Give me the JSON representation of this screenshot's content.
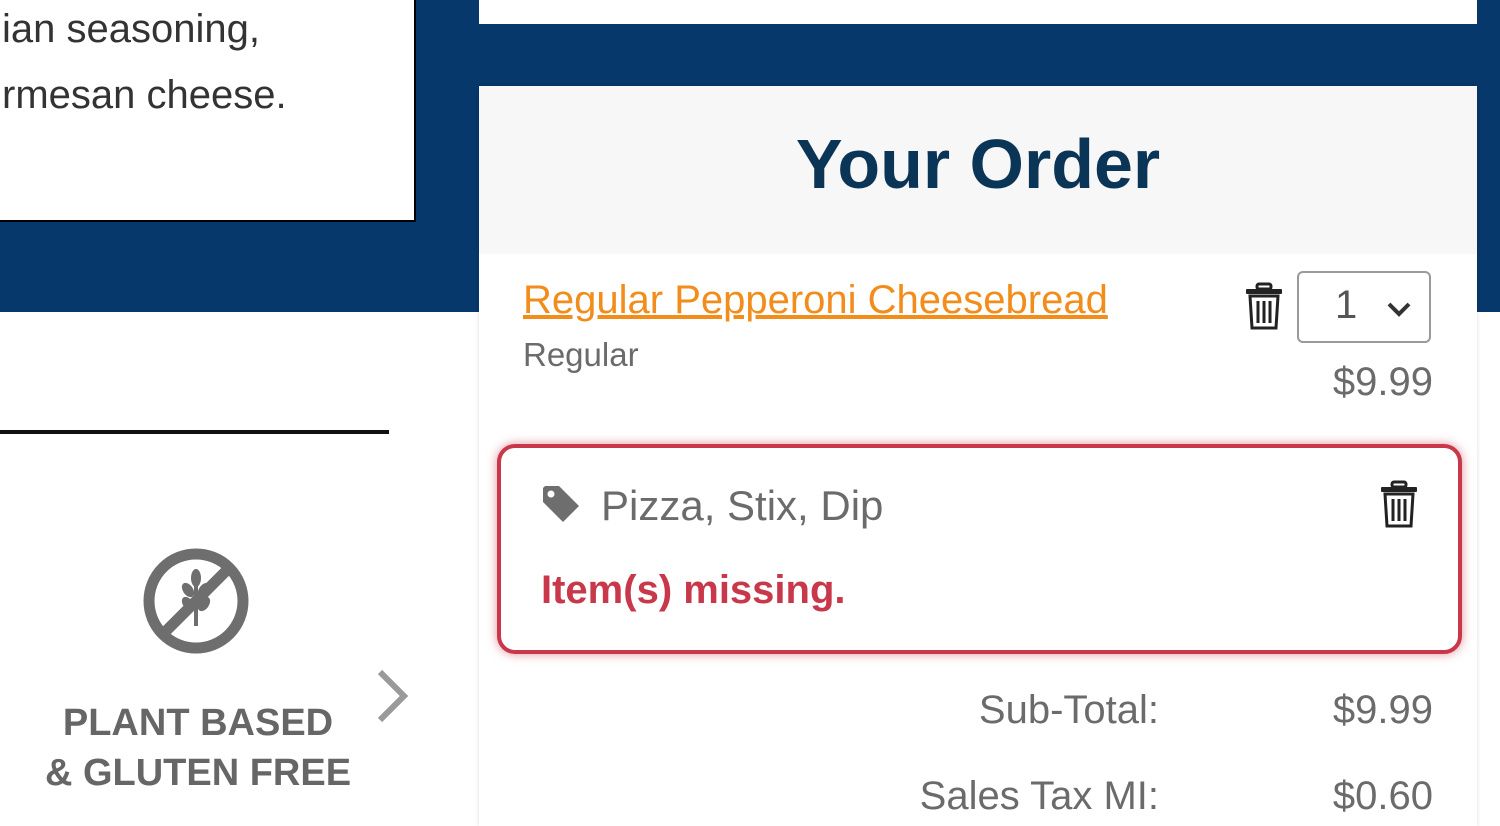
{
  "description": {
    "line1": "ian seasoning,",
    "line2": "rmesan cheese."
  },
  "sidebar": {
    "gluten_free_label_line1": "PLANT BASED",
    "gluten_free_label_line2": "& GLUTEN FREE"
  },
  "order": {
    "title": "Your Order",
    "item": {
      "name": "Regular Pepperoni Cheesebread",
      "variant": "Regular",
      "quantity": "1",
      "price": "$9.99"
    },
    "promo": {
      "name": "Pizza, Stix, Dip",
      "error": "Item(s) missing."
    },
    "summary": {
      "subtotal_label": "Sub-Total:",
      "subtotal_value": "$9.99",
      "tax_label": "Sales Tax MI:",
      "tax_value": "$0.60"
    }
  },
  "colors": {
    "navy": "#06386b",
    "title": "#0b3557",
    "link_orange": "#f28c1b",
    "error_red": "#c8384a"
  },
  "icons": [
    "gluten-free-icon",
    "chevron-right-icon",
    "trash-icon",
    "tag-icon",
    "chevron-down-icon"
  ]
}
